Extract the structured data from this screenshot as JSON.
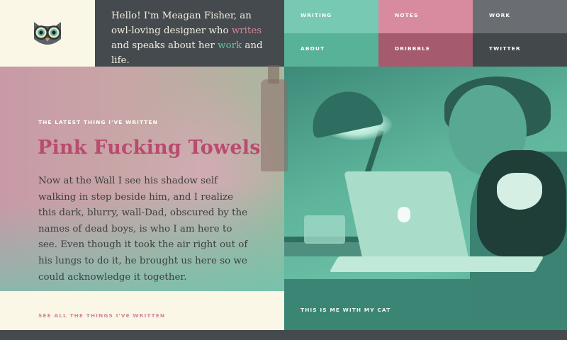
{
  "header": {
    "intro": {
      "before": "Hello! I'm Meagan Fisher, an owl-loving designer who ",
      "writes_link": "writes",
      "middle": " and speaks about her ",
      "work_link": "work",
      "after": " and life."
    }
  },
  "nav": {
    "writing": "WRITING",
    "notes": "NOTES",
    "work": "WORK",
    "about": "ABOUT",
    "dribbble": "DRIBBBLE",
    "twitter": "TWITTER"
  },
  "feature": {
    "eyebrow": "THE LATEST THING I'VE WRITTEN",
    "title": "Pink Fucking Towels",
    "excerpt": "Now at the Wall I see his shadow self walking in step beside him, and I realize this dark, blurry, wall-Dad, obscured by the names of dead boys, is who I am here to see. Even though it took the air right out of his lungs to do it, he brought us here so we could acknowledge it together.",
    "see_all": "SEE ALL THE THINGS I'VE WRITTEN",
    "photo_caption": "THIS IS ME WITH MY CAT"
  },
  "colors": {
    "cream": "#faf7e6",
    "charcoal": "#444a4e",
    "mint": "#78c9b3",
    "rose": "#d88b9f",
    "title_pink": "#b94c6e"
  },
  "icons": {
    "logo": "owl-icon"
  }
}
